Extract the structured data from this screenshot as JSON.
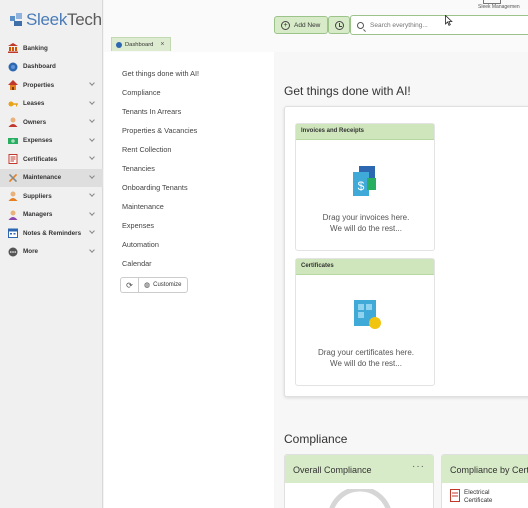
{
  "app": {
    "logo_text_a": "Sleek",
    "logo_text_b": "Tech",
    "user_label": "Sleek Managemen"
  },
  "sidebar": {
    "items": [
      {
        "label": "Banking",
        "icon": "bank-icon",
        "chevron": false
      },
      {
        "label": "Dashboard",
        "icon": "dashboard-icon",
        "chevron": false
      },
      {
        "label": "Properties",
        "icon": "house-icon",
        "chevron": true
      },
      {
        "label": "Leases",
        "icon": "key-icon",
        "chevron": true
      },
      {
        "label": "Owners",
        "icon": "person-icon",
        "chevron": true
      },
      {
        "label": "Expenses",
        "icon": "money-icon",
        "chevron": true
      },
      {
        "label": "Certificates",
        "icon": "certificate-icon",
        "chevron": true
      },
      {
        "label": "Maintenance",
        "icon": "tools-icon",
        "chevron": true
      },
      {
        "label": "Suppliers",
        "icon": "person-icon",
        "chevron": true
      },
      {
        "label": "Managers",
        "icon": "person-icon",
        "chevron": true
      },
      {
        "label": "Notes & Reminders",
        "icon": "calendar-icon",
        "chevron": true
      },
      {
        "label": "More",
        "icon": "more-icon",
        "chevron": true
      }
    ],
    "active_index": 7
  },
  "toolbar": {
    "add_label": "Add New",
    "search_placeholder": "Search everything..."
  },
  "tabs": [
    {
      "label": "Dashboard",
      "close": "×"
    }
  ],
  "menu": {
    "links": [
      "Get things done with AI!",
      "Compliance",
      "Tenants In Arrears",
      "Properties & Vacancies",
      "Rent Collection",
      "Tenancies",
      "Onboarding Tenants",
      "Maintenance",
      "Expenses",
      "Automation",
      "Calendar"
    ],
    "customize_label": "Customize"
  },
  "main": {
    "ai_heading": "Get things done with AI!",
    "cards": [
      {
        "title": "Invoices and Receipts",
        "line1": "Drag your invoices here.",
        "line2": "We will do the rest..."
      },
      {
        "title": "Certificates",
        "line1": "Drag your certificates here.",
        "line2": "We will do the rest..."
      }
    ],
    "compliance_heading": "Compliance",
    "overall_title": "Overall Compliance",
    "overall_menu": "···",
    "by_cert_title": "Compliance by Cert",
    "electrical_line1": "Electrical",
    "electrical_line2": "Certificate"
  },
  "colors": {
    "accent_green": "#cfe6bd",
    "brand_blue": "#4a7bb8"
  }
}
